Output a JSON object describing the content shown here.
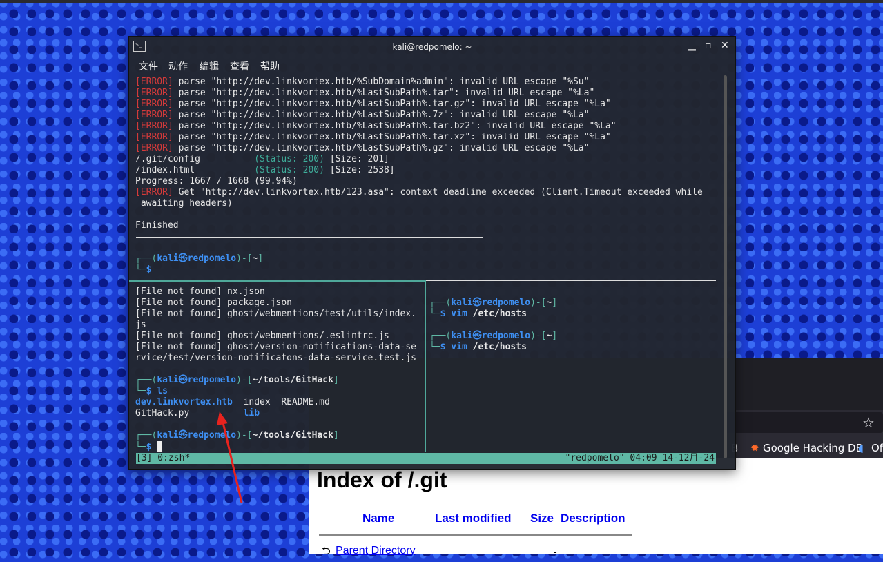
{
  "browser": {
    "bookmarks": [
      {
        "label": "B",
        "icon": "exploit-db-icon"
      },
      {
        "label": "Google Hacking DB",
        "icon": "google-hacking-db-icon"
      },
      {
        "label": "Of",
        "icon": "offsec-icon"
      }
    ],
    "page": {
      "title": "Index of /.git",
      "headers": [
        "Name",
        "Last modified",
        "Size",
        "Description"
      ],
      "rows": [
        {
          "name": "Parent Directory",
          "size": "-"
        }
      ]
    }
  },
  "terminal": {
    "title": "kali@redpomelo: ~",
    "menu": [
      "文件",
      "动作",
      "编辑",
      "查看",
      "帮助"
    ],
    "top_lines": [
      [
        [
          "[ERROR]",
          "err"
        ],
        [
          " parse \"http://dev.linkvortex.htb/%SubDomain%admin\": invalid URL escape \"%Su\"",
          ""
        ]
      ],
      [
        [
          "[ERROR]",
          "err"
        ],
        [
          " parse \"http://dev.linkvortex.htb/%LastSubPath%.tar\": invalid URL escape \"%La\"",
          ""
        ]
      ],
      [
        [
          "[ERROR]",
          "err"
        ],
        [
          " parse \"http://dev.linkvortex.htb/%LastSubPath%.tar.gz\": invalid URL escape \"%La\"",
          ""
        ]
      ],
      [
        [
          "[ERROR]",
          "err"
        ],
        [
          " parse \"http://dev.linkvortex.htb/%LastSubPath%.7z\": invalid URL escape \"%La\"",
          ""
        ]
      ],
      [
        [
          "[ERROR]",
          "err"
        ],
        [
          " parse \"http://dev.linkvortex.htb/%LastSubPath%.tar.bz2\": invalid URL escape \"%La\"",
          ""
        ]
      ],
      [
        [
          "[ERROR]",
          "err"
        ],
        [
          " parse \"http://dev.linkvortex.htb/%LastSubPath%.tar.xz\": invalid URL escape \"%La\"",
          ""
        ]
      ],
      [
        [
          "[ERROR]",
          "err"
        ],
        [
          " parse \"http://dev.linkvortex.htb/%LastSubPath%.gz\": invalid URL escape \"%La\"",
          ""
        ]
      ],
      [
        [
          "/.git/config          ",
          ""
        ],
        [
          "(Status: 200)",
          "st"
        ],
        [
          " [Size: 201]",
          ""
        ]
      ],
      [
        [
          "/index.html           ",
          ""
        ],
        [
          "(Status: 200)",
          "st"
        ],
        [
          " [Size: 2538]",
          ""
        ]
      ],
      [
        [
          "Progress: 1667 / 1668 (99.94%)",
          ""
        ]
      ],
      [
        [
          "[ERROR]",
          "err"
        ],
        [
          " Get \"http://dev.linkvortex.htb/123.asa\": context deadline exceeded (Client.Timeout exceeded while",
          ""
        ]
      ],
      [
        [
          " awaiting headers)",
          ""
        ]
      ],
      [
        [
          "",
          ""
        ]
      ],
      [
        [
          "Finished",
          ""
        ]
      ],
      [
        [
          "",
          ""
        ]
      ],
      [
        [
          "",
          ""
        ]
      ],
      [
        [
          "┌──(",
          "g"
        ],
        [
          "kali㉿redpomelo",
          "pr"
        ],
        [
          ")-[",
          "g"
        ],
        [
          "~",
          "b"
        ],
        [
          "]",
          "g"
        ]
      ],
      [
        [
          "└─",
          "g"
        ],
        [
          "$",
          "pr"
        ]
      ]
    ],
    "left_lines": [
      [
        [
          "[File not found] nx.json",
          ""
        ]
      ],
      [
        [
          "[File not found] package.json",
          ""
        ]
      ],
      [
        [
          "[File not found] ghost/webmentions/test/utils/index.",
          ""
        ]
      ],
      [
        [
          "js",
          ""
        ]
      ],
      [
        [
          "[File not found] ghost/webmentions/.eslintrc.js",
          ""
        ]
      ],
      [
        [
          "[File not found] ghost/version-notifications-data-se",
          ""
        ]
      ],
      [
        [
          "rvice/test/version-notificatons-data-service.test.js",
          ""
        ]
      ],
      [
        [
          "",
          ""
        ]
      ],
      [
        [
          "┌──(",
          "g"
        ],
        [
          "kali㉿redpomelo",
          "pr"
        ],
        [
          ")-[",
          "g"
        ],
        [
          "~/tools/GitHack",
          "b"
        ],
        [
          "]",
          "g"
        ]
      ],
      [
        [
          "└─",
          "g"
        ],
        [
          "$",
          "pr"
        ],
        [
          " ls",
          "dir"
        ]
      ],
      [
        [
          "dev.linkvortex.htb",
          "dir"
        ],
        [
          "  index  README.md",
          ""
        ]
      ],
      [
        [
          "GitHack.py          ",
          ""
        ],
        [
          "lib",
          "dir"
        ]
      ],
      [
        [
          "",
          ""
        ]
      ],
      [
        [
          "┌──(",
          "g"
        ],
        [
          "kali㉿redpomelo",
          "pr"
        ],
        [
          ")-[",
          "g"
        ],
        [
          "~/tools/GitHack",
          "b"
        ],
        [
          "]",
          "g"
        ]
      ],
      [
        [
          "└─",
          "g"
        ],
        [
          "$ ",
          "pr"
        ]
      ]
    ],
    "right_lines": [
      [
        [
          "",
          ""
        ]
      ],
      [
        [
          "┌──(",
          "g"
        ],
        [
          "kali㉿redpomelo",
          "pr"
        ],
        [
          ")-[",
          "g"
        ],
        [
          "~",
          "b"
        ],
        [
          "]",
          "g"
        ]
      ],
      [
        [
          "└─",
          "g"
        ],
        [
          "$",
          "pr"
        ],
        [
          " vim ",
          "dir"
        ],
        [
          "/etc/hosts",
          "b"
        ]
      ],
      [
        [
          "",
          ""
        ]
      ],
      [
        [
          "┌──(",
          "g"
        ],
        [
          "kali㉿redpomelo",
          "pr"
        ],
        [
          ")-[",
          "g"
        ],
        [
          "~",
          "b"
        ],
        [
          "]",
          "g"
        ]
      ],
      [
        [
          "└─",
          "g"
        ],
        [
          "$",
          "pr"
        ],
        [
          " vim ",
          "dir"
        ],
        [
          "/etc/hosts",
          "b"
        ]
      ]
    ],
    "status_left": "[3] 0:zsh*",
    "status_right": "\"redpomelo\" 04:09 14-12月-24"
  },
  "colors": {
    "error": "#d33a3a",
    "status": "#3fae9b",
    "prompt": "#3e8ff2",
    "tmux_bar": "#5fb8a5",
    "annotation_arrow": "#e8231e"
  }
}
